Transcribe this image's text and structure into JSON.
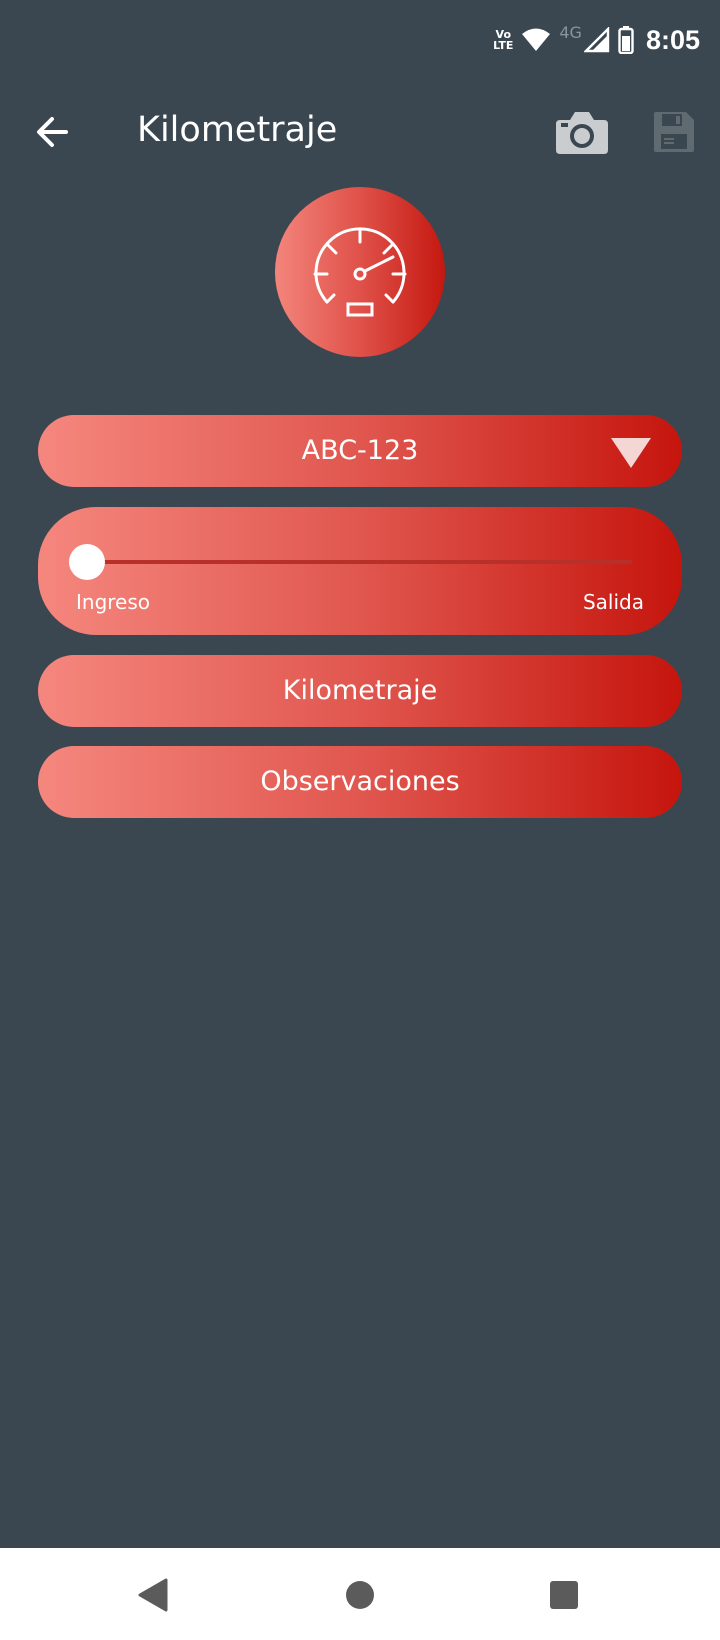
{
  "status_bar": {
    "volte_line1": "Vo",
    "volte_line2": "LTE",
    "network": "4G",
    "time": "8:05"
  },
  "app_bar": {
    "title": "Kilometraje",
    "back_icon": "arrow-left-icon",
    "camera_icon": "camera-icon",
    "save_icon": "floppy-disk-icon"
  },
  "badge": {
    "icon": "speedometer-icon"
  },
  "plate_select": {
    "selected": "ABC-123",
    "arrow_icon": "triangle-down-icon"
  },
  "direction_slider": {
    "left_label": "Ingreso",
    "right_label": "Salida",
    "value": 0
  },
  "mileage_field": {
    "placeholder": "Kilometraje",
    "value": ""
  },
  "notes_field": {
    "placeholder": "Observaciones",
    "value": ""
  },
  "colors": {
    "background": "#3a4750",
    "accent_light": "#f5877e",
    "accent_dark": "#c5150d",
    "disabled_icon": "#5f6a71"
  }
}
